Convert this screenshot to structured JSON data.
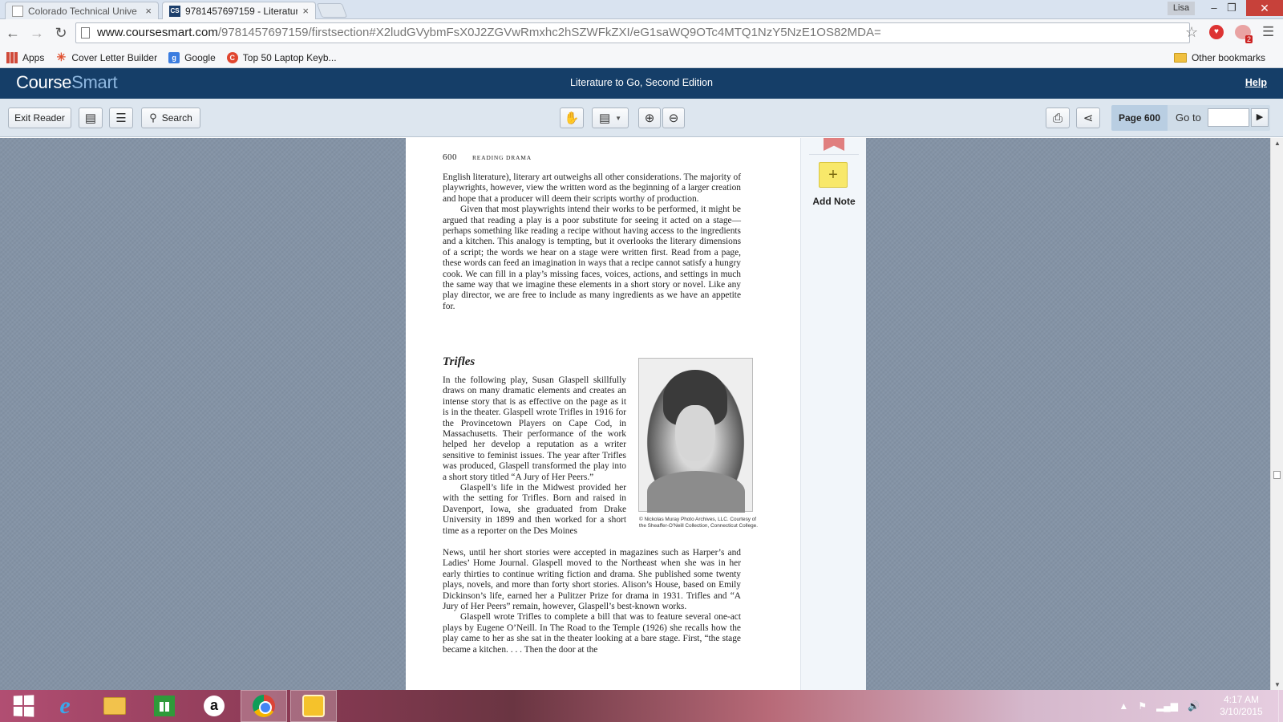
{
  "browser": {
    "tabs": [
      {
        "title": "Colorado Technical Unive",
        "favicon": "document-icon",
        "active": false
      },
      {
        "title": "9781457697159 - Literatur",
        "favicon": "coursesmart-icon",
        "favicon_text": "CS",
        "active": true
      }
    ],
    "user_badge": "Lisa",
    "window_controls": {
      "minimize": "–",
      "restore": "❐",
      "close": "✕"
    },
    "url_host": "www.coursesmart.com",
    "url_path": "/9781457697159/firstsection#X2ludGVybmFsX0J2ZGVwRmxhc2hSZWFkZXI/eG1saWQ9OTc4MTQ1NzY5NzE1OS82MDA=",
    "extension_badge": "2",
    "bookmarks": [
      "Apps",
      "Cover Letter Builder",
      "Google",
      "Top 50 Laptop Keyb..."
    ],
    "other_bookmarks": "Other bookmarks"
  },
  "coursesmart": {
    "logo_course": "Course",
    "logo_smart": "Smart",
    "book_title": "Literature to Go, Second Edition",
    "help_label": "Help",
    "toolbar": {
      "exit_label": "Exit Reader",
      "search_label": "Search",
      "page_label": "Page 600",
      "goto_label": "Go to",
      "goto_value": ""
    },
    "note_panel": {
      "add_note_label": "Add Note",
      "add_symbol": "+"
    }
  },
  "book_page": {
    "page_number": "600",
    "section_heading": "READING DRAMA",
    "para1": "English literature), literary art outweighs all other considerations. The majority of playwrights, however, view the written word as the beginning of a larger creation and hope that a producer will deem their scripts worthy of production.",
    "para2": "Given that most playwrights intend their works to be performed, it might be argued that reading a play is a poor substitute for seeing it acted on a stage—perhaps something like reading a recipe without having access to the ingredients and a kitchen. This analogy is tempting, but it overlooks the literary dimensions of a script; the words we hear on a stage were written first. Read from a page, these words can feed an imagination in ways that a recipe cannot satisfy a hungry cook. We can fill in a play’s missing faces, voices, actions, and settings in much the same way that we imagine these elements in a short story or novel. Like any play director, we are free to include as many ingredients as we have an appetite for.",
    "heading": "Trifles",
    "para3": "In the following play, Susan Glaspell skillfully draws on many dramatic elements and creates an intense story that is as effective on the page as it is in the theater. Glaspell wrote Trifles in 1916 for the Provincetown Players on Cape Cod, in Massachusetts. Their performance of the work helped her develop a reputation as a writer sensitive to feminist issues. The year after Trifles was produced, Glaspell transformed the play into a short story titled “A Jury of Her Peers.”",
    "para4a": "Glaspell’s life in the Midwest provided her with the setting for Trifles. Born and raised in Davenport, Iowa, she graduated from Drake University in 1899 and then worked for a short time as a reporter on the Des Moines",
    "para4b": "News, until her short stories were accepted in magazines such as Harper’s and Ladies’ Home Journal. Glaspell moved to the Northeast when she was in her early thirties to continue writing fiction and drama. She published some twenty plays, novels, and more than forty short stories. Alison’s House, based on Emily Dickinson’s life, earned her a Pulitzer Prize for drama in 1931. Trifles and “A Jury of Her Peers” remain, however, Glaspell’s best-known works.",
    "para5": "Glaspell wrote Trifles to complete a bill that was to feature several one-act plays by Eugene O’Neill. In The Road to the Temple (1926) she recalls how the play came to her as she sat in the theater looking at a bare stage. First, “the stage became a kitchen. . . . Then the door at the",
    "photo_credit": "© Nickolas Muray Photo Archives, LLC. Courtesy of the Sheaffer-O’Neill Collection, Connecticut College."
  },
  "taskbar": {
    "apps": [
      "start-button",
      "internet-explorer-icon",
      "file-explorer-icon",
      "store-icon",
      "amazon-icon",
      "chrome-icon",
      "coursesmart-app-icon"
    ],
    "amazon_glyph": "a",
    "ie_glyph": "e",
    "time": "4:17 AM",
    "date": "3/10/2015"
  },
  "colors": {
    "coursesmart_header": "#153e68",
    "toolbar_bg": "#dde6ef",
    "viewer_bg": "#8493a6",
    "note_yellow": "#f8e86a",
    "bookmark_ribbon": "#e07f7f"
  }
}
